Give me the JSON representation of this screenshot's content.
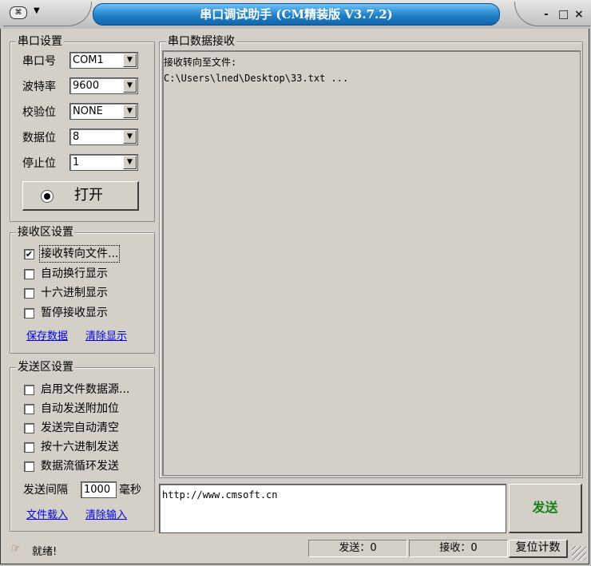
{
  "window": {
    "title": "串口调试助手 (CM精装版 V3.7.2)",
    "sys_icon": "⌘",
    "sys_arrow": "▼",
    "minimize": "-",
    "maximize": "□",
    "close": "×"
  },
  "serial_settings": {
    "title": "串口设置",
    "port_label": "串口号",
    "port_value": "COM1",
    "baud_label": "波特率",
    "baud_value": "9600",
    "parity_label": "校验位",
    "parity_value": "NONE",
    "databits_label": "数据位",
    "databits_value": "8",
    "stopbits_label": "停止位",
    "stopbits_value": "1",
    "open_label": "打开",
    "combo_arrow": "▼"
  },
  "receive_settings": {
    "title": "接收区设置",
    "options": [
      {
        "label": "接收转向文件...",
        "checked": true
      },
      {
        "label": "自动换行显示",
        "checked": false
      },
      {
        "label": "十六进制显示",
        "checked": false
      },
      {
        "label": "暂停接收显示",
        "checked": false
      }
    ],
    "save_link": "保存数据",
    "clear_link": "清除显示"
  },
  "send_settings": {
    "title": "发送区设置",
    "options": [
      {
        "label": "启用文件数据源...",
        "checked": false
      },
      {
        "label": "自动发送附加位",
        "checked": false
      },
      {
        "label": "发送完自动清空",
        "checked": false
      },
      {
        "label": "按十六进制发送",
        "checked": false
      },
      {
        "label": "数据流循环发送",
        "checked": false
      }
    ],
    "interval_label": "发送间隔",
    "interval_value": "1000",
    "interval_unit": "毫秒",
    "load_link": "文件载入",
    "clear_link": "清除输入"
  },
  "receive_area": {
    "title": "串口数据接收",
    "lines": [
      "接收转向至文件:",
      "C:\\Users\\lned\\Desktop\\33.txt ..."
    ]
  },
  "send_area": {
    "text": "http://www.cmsoft.cn",
    "send_label": "发送"
  },
  "status": {
    "icon": "☞",
    "text": "就绪!",
    "sent": "发送：0",
    "received": "接收：0",
    "reset_label": "复位计数"
  }
}
